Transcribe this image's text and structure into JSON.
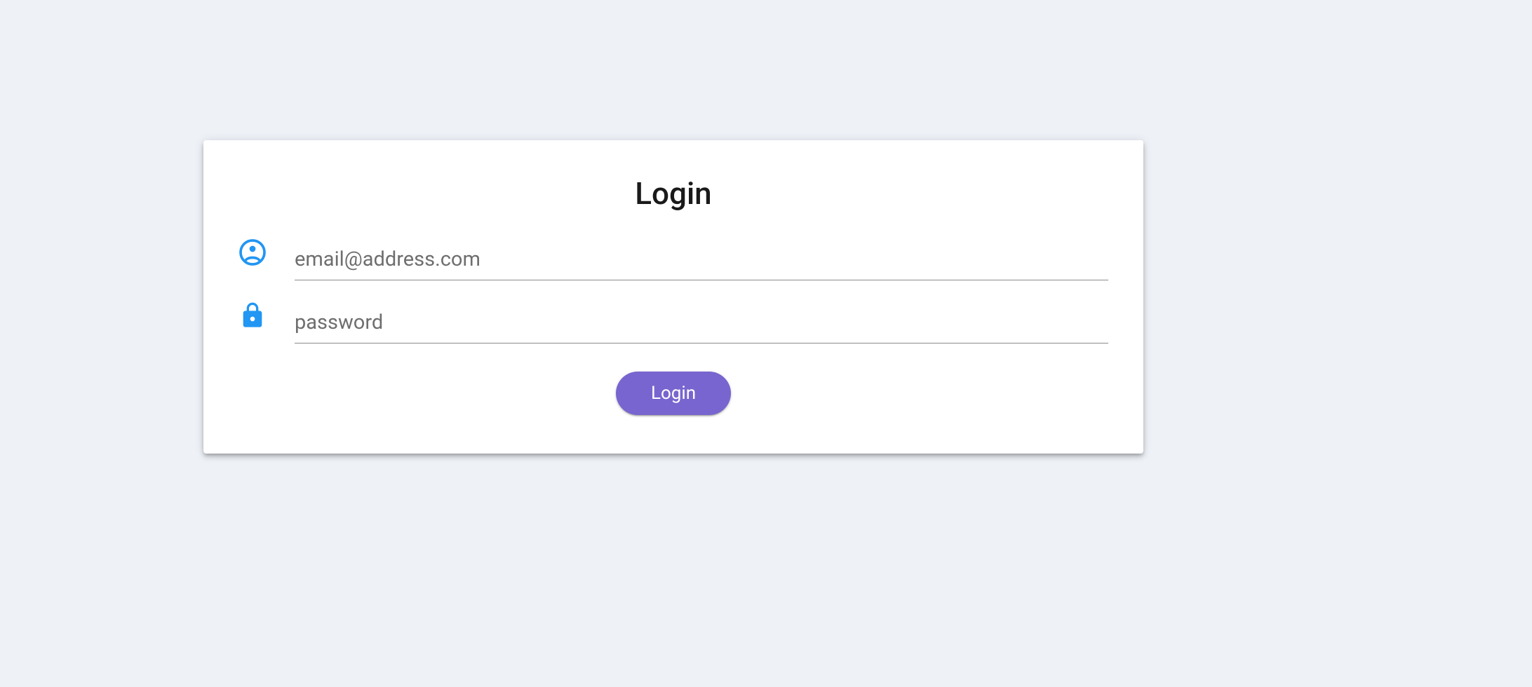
{
  "form": {
    "title": "Login",
    "email": {
      "placeholder": "email@address.com",
      "value": ""
    },
    "password": {
      "placeholder": "password",
      "value": ""
    },
    "submit_label": "Login"
  },
  "colors": {
    "icon_blue": "#2196f3",
    "button_purple": "#7965cf",
    "background": "#eef2f7"
  }
}
